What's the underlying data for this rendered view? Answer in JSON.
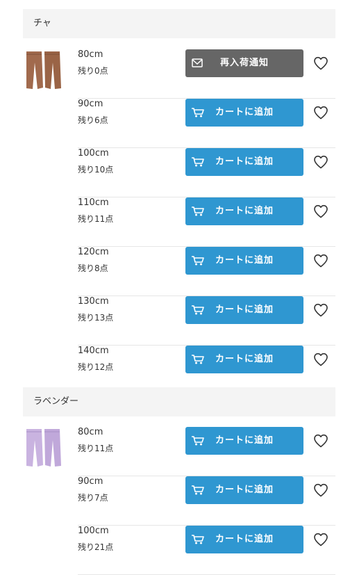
{
  "groups": [
    {
      "color_name": "チャ",
      "items": [
        {
          "size": "80cm",
          "stock": "残り0点",
          "action": "再入荷通知",
          "type": "notify"
        },
        {
          "size": "90cm",
          "stock": "残り6点",
          "action": "カートに追加",
          "type": "cart"
        },
        {
          "size": "100cm",
          "stock": "残り10点",
          "action": "カートに追加",
          "type": "cart"
        },
        {
          "size": "110cm",
          "stock": "残り11点",
          "action": "カートに追加",
          "type": "cart"
        },
        {
          "size": "120cm",
          "stock": "残り8点",
          "action": "カートに追加",
          "type": "cart"
        },
        {
          "size": "130cm",
          "stock": "残り13点",
          "action": "カートに追加",
          "type": "cart"
        },
        {
          "size": "140cm",
          "stock": "残り12点",
          "action": "カートに追加",
          "type": "cart"
        }
      ]
    },
    {
      "color_name": "ラベンダー",
      "items": [
        {
          "size": "80cm",
          "stock": "残り11点",
          "action": "カートに追加",
          "type": "cart"
        },
        {
          "size": "90cm",
          "stock": "残り7点",
          "action": "カートに追加",
          "type": "cart"
        },
        {
          "size": "100cm",
          "stock": "残り21点",
          "action": "カートに追加",
          "type": "cart"
        }
      ]
    }
  ],
  "icons": {
    "cart": "cart-icon",
    "notify": "mail-icon",
    "favorite": "heart-icon"
  },
  "colors": {
    "cart_button": "#2f97d1",
    "notify_button": "#666666",
    "header_bg": "#f4f4f4",
    "brown_product": "#a16a4d",
    "lavender_product": "#c9b3e0"
  }
}
